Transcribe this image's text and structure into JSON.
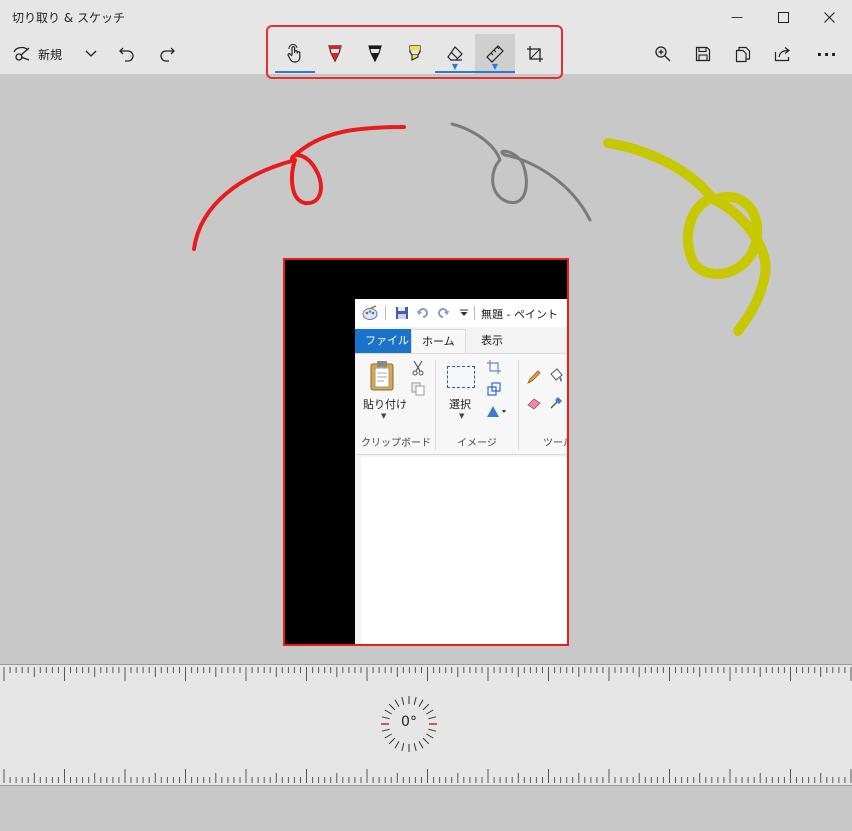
{
  "window": {
    "title": "切り取り & スケッチ",
    "minimize_glyph": "—",
    "maximize_glyph": "☐",
    "close_glyph": "✕"
  },
  "toolbar": {
    "new_label": "新規",
    "new_icon": "snip-icon",
    "dropdown_icon": "chevron-down-icon",
    "undo_icon": "undo-icon",
    "redo_icon": "redo-icon",
    "more_label": "···",
    "right_icons": [
      "zoom-icon",
      "save-icon",
      "copy-icon",
      "share-icon",
      "more-icon"
    ]
  },
  "tools": [
    {
      "name": "touch-writing",
      "icon": "touch-hand-icon",
      "selected": true
    },
    {
      "name": "ballpoint-pen",
      "icon": "pen-icon",
      "color": "#e81c1c"
    },
    {
      "name": "pencil",
      "icon": "pencil-icon",
      "color": "#1a1a1a"
    },
    {
      "name": "highlighter",
      "icon": "highlighter-icon",
      "color": "#f2e23a"
    },
    {
      "name": "eraser",
      "icon": "eraser-icon",
      "has_dropdown": true
    },
    {
      "name": "ruler",
      "icon": "ruler-icon",
      "has_dropdown": true,
      "active": true
    },
    {
      "name": "crop",
      "icon": "crop-icon"
    }
  ],
  "colors": {
    "accent": "#2e7ad1",
    "highlight_box": "#e53030",
    "red_stroke": "#e81c1c",
    "gray_stroke": "#7a7a7a",
    "yellow_stroke": "#c8c800"
  },
  "paint": {
    "title": "無題 - ペイント",
    "tabs": [
      "ファイル",
      "ホーム",
      "表示"
    ],
    "groups": [
      "クリップボード",
      "イメージ",
      "ツール"
    ],
    "paste_label": "貼り付け",
    "select_label": "選択"
  },
  "ruler": {
    "angle": "0°"
  }
}
